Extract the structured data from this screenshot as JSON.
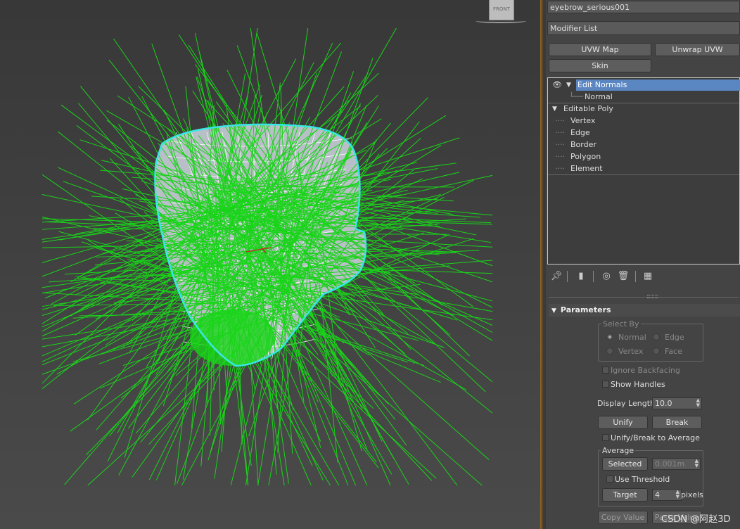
{
  "panel": {
    "object_name": "eyebrow_serious001",
    "modifier_list": "Modifier List",
    "buttons": [
      "UVW Map",
      "Unwrap UVW",
      "Skin"
    ]
  },
  "viewport": {
    "viewcube_label": "FRONT",
    "normals_color": "#19d419",
    "selection_outline_color": "#38e6e6"
  },
  "stack": {
    "edit_normals": "Edit Normals",
    "normal": "Normal",
    "editable_poly": "Editable Poly",
    "subobjects": [
      "Vertex",
      "Edge",
      "Border",
      "Polygon",
      "Element"
    ]
  },
  "tools": [
    "pin-icon",
    "show-end-result-icon",
    "make-unique-icon",
    "remove-modifier-icon",
    "configure-modifier-sets-icon"
  ],
  "parameters": {
    "title": "Parameters",
    "select_by": "Select By",
    "normal": "Normal",
    "edge": "Edge",
    "vertex": "Vertex",
    "face": "Face",
    "ignore_backfacing": "Ignore Backfacing",
    "show_handles": "Show Handles",
    "display_length_label": "Display Length:",
    "display_length_value": "10.0",
    "unify": "Unify",
    "break": "Break",
    "unify_break_avg": "Unify/Break to Average",
    "average": "Average",
    "selected": "Selected",
    "selected_value": "0.001m",
    "use_threshold": "Use Threshold",
    "target": "Target",
    "target_value": "4",
    "pixels": "pixels",
    "copy_value": "Copy Value",
    "paste_value": "Paste Value"
  },
  "watermark": "CSDN @阿赵3D"
}
